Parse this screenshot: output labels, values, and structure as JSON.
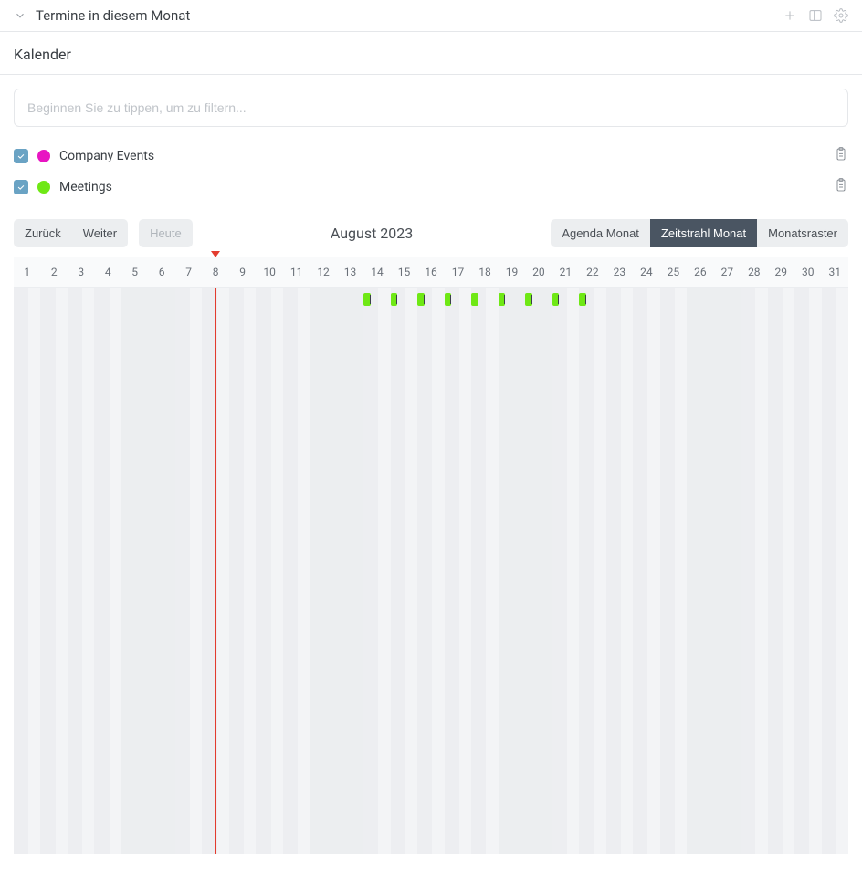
{
  "header": {
    "title": "Termine in diesem Monat"
  },
  "section": {
    "title": "Kalender"
  },
  "filter": {
    "placeholder": "Beginnen Sie zu tippen, um zu filtern..."
  },
  "calendars": [
    {
      "name": "Company Events",
      "color": "#e815c2",
      "checked": true
    },
    {
      "name": "Meetings",
      "color": "#6fe815",
      "checked": true
    }
  ],
  "nav": {
    "back": "Zurück",
    "forward": "Weiter",
    "today": "Heute"
  },
  "views": {
    "agenda": "Agenda Monat",
    "timeline": "Zeitstrahl Monat",
    "grid": "Monatsraster"
  },
  "month_label": "August 2023",
  "days_in_month": 31,
  "today_day": 8,
  "weekend_days": [
    5,
    6,
    12,
    13,
    19,
    20,
    26,
    27
  ],
  "events": [
    {
      "day": 14,
      "color": "#6fe815"
    },
    {
      "day": 15,
      "color": "#6fe815"
    },
    {
      "day": 16,
      "color": "#6fe815"
    },
    {
      "day": 17,
      "color": "#6fe815"
    },
    {
      "day": 18,
      "color": "#6fe815"
    },
    {
      "day": 19,
      "color": "#6fe815"
    },
    {
      "day": 20,
      "color": "#6fe815"
    },
    {
      "day": 21,
      "color": "#6fe815"
    },
    {
      "day": 22,
      "color": "#6fe815"
    }
  ]
}
